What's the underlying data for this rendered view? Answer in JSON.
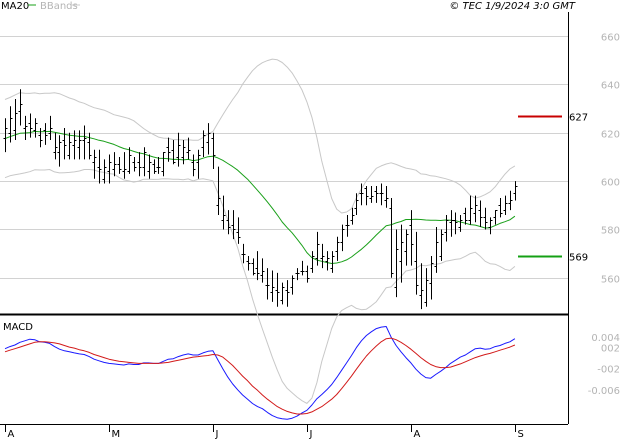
{
  "header": {
    "legend": [
      {
        "name": "MA20",
        "color": "#1aa01a"
      },
      {
        "name": "BBands",
        "color": "#c8c8c8"
      }
    ],
    "copyright": "© TEC 1/9/2024 3:0 GMT"
  },
  "colors": {
    "grid": "#d2d2d2",
    "price_bars": "#000000",
    "ma20": "#1aa01a",
    "bbands": "#c8c8c8",
    "macd_line": "#1a1aff",
    "signal_line": "#d21a1a",
    "resistance": "#c80000",
    "support": "#14a014"
  },
  "chart_data": [
    {
      "type": "line",
      "panel": "price",
      "ylim": [
        545,
        670
      ],
      "yticks": [
        {
          "value": 660,
          "label": "660"
        },
        {
          "value": 640,
          "label": "640"
        },
        {
          "value": 620,
          "label": "620"
        },
        {
          "value": 600,
          "label": "600"
        },
        {
          "value": 580,
          "label": "580"
        },
        {
          "value": 560,
          "label": "560"
        }
      ],
      "xticks": [
        {
          "label": "A",
          "index": 0
        },
        {
          "label": "M",
          "index": 21
        },
        {
          "label": "J",
          "index": 42
        },
        {
          "label": "J",
          "index": 61
        },
        {
          "label": "A",
          "index": 82
        },
        {
          "label": "S",
          "index": 103
        }
      ],
      "levels": [
        {
          "name": "resistance",
          "value": 627,
          "label": "627"
        },
        {
          "name": "support",
          "value": 569,
          "label": "569"
        }
      ],
      "ohlc": {
        "high": [
          626,
          631,
          634,
          638,
          627,
          628,
          626,
          622,
          624,
          627,
          620,
          619,
          622,
          620,
          621,
          621,
          623,
          620,
          613,
          613,
          609,
          611,
          612,
          610,
          612,
          614,
          610,
          612,
          614,
          611,
          609,
          610,
          612,
          618,
          617,
          620,
          617,
          618,
          611,
          613,
          621,
          624,
          620,
          606,
          594,
          588,
          588,
          585,
          574,
          569,
          568,
          571,
          568,
          564,
          563,
          562,
          558,
          559,
          561,
          564,
          567,
          565,
          571,
          579,
          574,
          571,
          571,
          577,
          582,
          586,
          589,
          595,
          599,
          598,
          598,
          598,
          599,
          598,
          593,
          580,
          582,
          580,
          588,
          579,
          566,
          564,
          569,
          581,
          580,
          586,
          588,
          587,
          586,
          589,
          594,
          594,
          592,
          589,
          585,
          588,
          593,
          594,
          596,
          600
        ],
        "low": [
          612,
          616,
          617,
          623,
          617,
          618,
          618,
          614,
          615,
          617,
          609,
          606,
          609,
          609,
          609,
          609,
          609,
          609,
          601,
          599,
          599,
          599,
          602,
          603,
          601,
          603,
          604,
          602,
          602,
          601,
          603,
          603,
          602,
          608,
          607,
          606,
          607,
          609,
          602,
          601,
          610,
          611,
          605,
          586,
          580,
          578,
          576,
          574,
          566,
          563,
          561,
          559,
          558,
          551,
          550,
          548,
          549,
          548,
          553,
          559,
          561,
          558,
          562,
          565,
          564,
          563,
          562,
          567,
          571,
          577,
          582,
          586,
          590,
          590,
          591,
          591,
          590,
          589,
          560,
          552,
          558,
          565,
          565,
          553,
          547,
          548,
          551,
          562,
          567,
          575,
          577,
          578,
          579,
          582,
          582,
          583,
          581,
          580,
          578,
          582,
          585,
          586,
          588,
          592
        ],
        "open": [
          618,
          620,
          621,
          629,
          622,
          624,
          621,
          619,
          621,
          620,
          612,
          612,
          617,
          611,
          615,
          614,
          617,
          616,
          608,
          606,
          601,
          604,
          605,
          607,
          604,
          604,
          608,
          608,
          606,
          604,
          607,
          606,
          604,
          614,
          613,
          610,
          610,
          612,
          608,
          608,
          614,
          616,
          618,
          590,
          584,
          584,
          582,
          579,
          570,
          567,
          566,
          564,
          561,
          557,
          554,
          555,
          551,
          555,
          556,
          562,
          563,
          563,
          564,
          568,
          568,
          567,
          564,
          571,
          575,
          582,
          584,
          589,
          595,
          597,
          593,
          596,
          595,
          592,
          589,
          556,
          567,
          571,
          582,
          567,
          553,
          550,
          558,
          565,
          569,
          579,
          583,
          584,
          581,
          587,
          584,
          587,
          588,
          585,
          581,
          585,
          590,
          588,
          591,
          595
        ],
        "close": [
          622,
          626,
          628,
          632,
          623,
          622,
          624,
          617,
          619,
          622,
          614,
          616,
          615,
          616,
          617,
          617,
          618,
          611,
          610,
          605,
          606,
          608,
          607,
          605,
          605,
          611,
          606,
          606,
          612,
          608,
          604,
          606,
          612,
          612,
          608,
          615,
          614,
          613,
          605,
          611,
          619,
          620,
          611,
          593,
          586,
          581,
          580,
          577,
          570,
          566,
          562,
          562,
          563,
          557,
          556,
          554,
          556,
          554,
          560,
          562,
          563,
          560,
          569,
          574,
          569,
          568,
          569,
          575,
          580,
          582,
          586,
          592,
          595,
          594,
          594,
          595,
          595,
          593,
          562,
          572,
          575,
          578,
          574,
          557,
          555,
          559,
          566,
          575,
          578,
          584,
          584,
          583,
          584,
          584,
          589,
          590,
          585,
          583,
          584,
          588,
          587,
          591,
          592,
          598
        ]
      },
      "series": [
        {
          "name": "MA20",
          "role": "ma20",
          "values": [
            617.6,
            618.4,
            619.1,
            619.8,
            619.9,
            620.1,
            620.6,
            620.4,
            620.5,
            620.6,
            620.2,
            619.8,
            619.4,
            619.0,
            618.8,
            618.5,
            618.5,
            618.0,
            617.5,
            616.9,
            616.5,
            615.8,
            615.2,
            614.3,
            613.5,
            613.0,
            612.3,
            611.7,
            611.3,
            610.6,
            610.0,
            609.5,
            609.4,
            609.3,
            609.0,
            609.0,
            608.8,
            609.0,
            608.5,
            608.8,
            609.5,
            610.1,
            610.3,
            609.6,
            608.6,
            607.3,
            606.0,
            604.5,
            602.6,
            600.8,
            598.5,
            596.2,
            593.9,
            591.4,
            588.8,
            586.0,
            583.1,
            580.7,
            578.6,
            576.0,
            573.4,
            570.4,
            568.3,
            567.3,
            566.8,
            566.3,
            565.9,
            566.1,
            566.6,
            567.4,
            568.6,
            570.2,
            571.8,
            573.6,
            575.6,
            577.7,
            579.6,
            581.5,
            581.9,
            582.7,
            583.3,
            584.1,
            584.1,
            584.2,
            584.1,
            583.9,
            583.8,
            583.8,
            583.7,
            583.9,
            583.8,
            583.6,
            583.1,
            582.6,
            582.0,
            581.8,
            581.2,
            580.6,
            580.7,
            581.6,
            582.5,
            583.2,
            584.0,
            585.5
          ]
        },
        {
          "name": "BBands",
          "role": "bb_upper",
          "values": [
            633.8,
            634.6,
            635.6,
            636.6,
            636.4,
            636.3,
            636.5,
            636.2,
            636.4,
            636.4,
            636.6,
            636.2,
            635.3,
            634.4,
            633.8,
            632.8,
            632.2,
            631.2,
            630.4,
            629.9,
            629.4,
            628.5,
            627.5,
            627.0,
            626.5,
            625.9,
            625.0,
            623.4,
            621.8,
            620.4,
            619.3,
            618.2,
            617.8,
            617.7,
            617.2,
            617.2,
            617.0,
            617.1,
            616.9,
            616.9,
            618.0,
            619.6,
            620.5,
            624.0,
            627.4,
            630.7,
            633.8,
            636.6,
            640.1,
            643.0,
            645.7,
            647.7,
            649.0,
            649.9,
            650.5,
            650.2,
            649.1,
            647.2,
            644.8,
            641.4,
            637.7,
            632.8,
            626.4,
            618.0,
            608.2,
            600.4,
            592.8,
            588.4,
            586.8,
            587.2,
            588.6,
            593.1,
            596.8,
            600.2,
            602.8,
            605.3,
            606.3,
            607.1,
            607.6,
            606.9,
            606.1,
            605.4,
            605.0,
            604.5,
            603.0,
            602.8,
            602.2,
            602.0,
            601.5,
            601.0,
            600.4,
            599.6,
            598.3,
            596.3,
            594.0,
            593.0,
            593.5,
            594.4,
            595.6,
            597.6,
            600.3,
            602.9,
            605.0,
            606.3
          ]
        },
        {
          "name": "BBands",
          "role": "bb_lower",
          "values": [
            601.4,
            602.2,
            602.6,
            603.0,
            603.4,
            603.9,
            604.7,
            604.6,
            604.6,
            604.8,
            603.8,
            603.4,
            603.5,
            603.6,
            603.8,
            604.2,
            604.8,
            604.8,
            604.6,
            603.9,
            603.6,
            603.1,
            602.9,
            601.6,
            600.5,
            600.1,
            599.6,
            600.0,
            600.8,
            600.8,
            600.7,
            600.8,
            601.0,
            600.9,
            600.8,
            600.8,
            600.6,
            600.9,
            600.1,
            600.7,
            601.0,
            600.6,
            600.1,
            595.2,
            589.8,
            583.9,
            578.2,
            572.4,
            565.1,
            558.6,
            551.3,
            544.7,
            538.8,
            532.9,
            527.1,
            521.8,
            517.1,
            514.2,
            512.4,
            510.6,
            509.1,
            508.0,
            510.2,
            516.6,
            525.4,
            532.2,
            539.0,
            543.8,
            546.4,
            547.6,
            548.6,
            547.3,
            546.8,
            547.0,
            548.4,
            550.1,
            552.9,
            555.9,
            556.2,
            558.5,
            560.5,
            562.8,
            563.2,
            563.9,
            565.2,
            565.0,
            565.4,
            565.6,
            565.9,
            566.8,
            567.2,
            567.6,
            567.9,
            568.9,
            570.0,
            570.6,
            568.9,
            566.8,
            565.8,
            565.6,
            564.7,
            563.5,
            563.0,
            564.7
          ]
        }
      ]
    },
    {
      "type": "line",
      "panel": "macd",
      "title": "MACD",
      "ylim": [
        -0.0125,
        0.008
      ],
      "yticks": [
        {
          "value": 0.004,
          "label": "0.004"
        },
        {
          "value": 0.002,
          "label": "002"
        },
        {
          "value": -0.002,
          "label": "-002"
        },
        {
          "value": -0.006,
          "label": "-0.006"
        }
      ],
      "series": [
        {
          "name": "MACD",
          "role": "macd_line",
          "values": [
            0.0018,
            0.0022,
            0.0025,
            0.003,
            0.0033,
            0.0036,
            0.0035,
            0.0031,
            0.003,
            0.0028,
            0.0022,
            0.0017,
            0.0014,
            0.0012,
            0.001,
            0.0008,
            0.0007,
            0.0003,
            -0.0002,
            -0.0005,
            -0.0008,
            -0.001,
            -0.0011,
            -0.0012,
            -0.0013,
            -0.0011,
            -0.0012,
            -0.0012,
            -0.0009,
            -0.0009,
            -0.001,
            -0.001,
            -0.0006,
            -0.0002,
            -0.0001,
            0.0003,
            0.0006,
            0.0008,
            0.0006,
            0.0006,
            0.001,
            0.0013,
            0.0014,
            -0.0003,
            -0.002,
            -0.0036,
            -0.0049,
            -0.006,
            -0.007,
            -0.0078,
            -0.0086,
            -0.0092,
            -0.0096,
            -0.0103,
            -0.0109,
            -0.0113,
            -0.0115,
            -0.0116,
            -0.0114,
            -0.011,
            -0.0104,
            -0.0099,
            -0.0089,
            -0.0077,
            -0.0069,
            -0.006,
            -0.005,
            -0.0037,
            -0.0023,
            -0.0009,
            0.0005,
            0.002,
            0.0033,
            0.0043,
            0.005,
            0.0056,
            0.0059,
            0.006,
            0.004,
            0.0024,
            0.0012,
            0.0001,
            -0.0009,
            -0.0021,
            -0.003,
            -0.0037,
            -0.0038,
            -0.0031,
            -0.0025,
            -0.0018,
            -0.001,
            -0.0004,
            0.0002,
            0.0006,
            0.0012,
            0.0018,
            0.0019,
            0.0017,
            0.0018,
            0.0022,
            0.0024,
            0.0028,
            0.0031,
            0.0037
          ]
        },
        {
          "name": "Signal",
          "role": "signal_line",
          "values": [
            0.0012,
            0.0015,
            0.0018,
            0.0021,
            0.0024,
            0.0027,
            0.003,
            0.0031,
            0.0031,
            0.003,
            0.0029,
            0.0027,
            0.0024,
            0.0021,
            0.0019,
            0.0016,
            0.0014,
            0.0011,
            0.0007,
            0.0004,
            0.0001,
            -0.0002,
            -0.0004,
            -0.0006,
            -0.0007,
            -0.0008,
            -0.0009,
            -0.001,
            -0.001,
            -0.001,
            -0.001,
            -0.001,
            -0.0009,
            -0.0008,
            -0.0006,
            -0.0004,
            -0.0002,
            0.0,
            0.0002,
            0.0003,
            0.0004,
            0.0005,
            0.0007,
            0.0006,
            0.0002,
            -0.0006,
            -0.0014,
            -0.0024,
            -0.0034,
            -0.0043,
            -0.0053,
            -0.0061,
            -0.007,
            -0.0078,
            -0.0085,
            -0.0092,
            -0.0097,
            -0.0101,
            -0.0104,
            -0.0106,
            -0.0106,
            -0.0105,
            -0.0102,
            -0.0097,
            -0.0092,
            -0.0085,
            -0.0078,
            -0.0069,
            -0.0058,
            -0.0046,
            -0.0034,
            -0.0021,
            -0.0008,
            0.0004,
            0.0014,
            0.0023,
            0.0031,
            0.0037,
            0.0038,
            0.0035,
            0.003,
            0.0024,
            0.0017,
            0.0009,
            0.0001,
            -0.0006,
            -0.0012,
            -0.0016,
            -0.0018,
            -0.0018,
            -0.0017,
            -0.0014,
            -0.0011,
            -0.0007,
            -0.0003,
            0.0001,
            0.0004,
            0.0007,
            0.0009,
            0.0012,
            0.0015,
            0.0018,
            0.0021,
            0.0025
          ]
        }
      ]
    }
  ]
}
